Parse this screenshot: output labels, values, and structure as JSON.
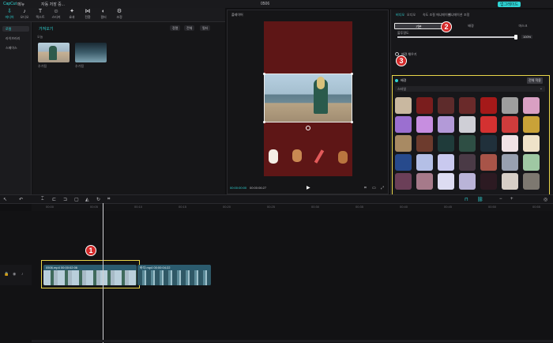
{
  "titlebar": {
    "app_label": "CapCut",
    "menu": "메뉴",
    "autosave": "자동 저장 중...",
    "title": "0506",
    "upgrade": "업그레이드"
  },
  "toolbar": {
    "tools": [
      {
        "icon": "media-icon",
        "label": "미디어"
      },
      {
        "icon": "audio-icon",
        "label": "오디오"
      },
      {
        "icon": "text-icon",
        "label": "텍스트"
      },
      {
        "icon": "sticker-icon",
        "label": "스티커"
      },
      {
        "icon": "effects-icon",
        "label": "효과"
      },
      {
        "icon": "transition-icon",
        "label": "전환"
      },
      {
        "icon": "filter-icon",
        "label": "필터"
      },
      {
        "icon": "adjust-icon",
        "label": "조정"
      }
    ]
  },
  "leftnav": {
    "items": [
      "로컬",
      "라이브러리",
      "스페이스"
    ]
  },
  "media": {
    "header": "가져오기",
    "section": "오늘",
    "buttons": [
      "정렬",
      "전체",
      "필터"
    ],
    "items": [
      {
        "caption": "추가됨"
      },
      {
        "caption": "추가됨"
      }
    ]
  },
  "player": {
    "header": "플레이어",
    "timecode_current": "00:00:00:00",
    "timecode_total": "00:00:06:27"
  },
  "props": {
    "tabs": [
      "비디오",
      "오디오",
      "속도 조절 애니메이션",
      "애니메이션",
      "조정"
    ],
    "segments": [
      "기본",
      "배경",
      "마스크"
    ],
    "blend_label": "불투명도",
    "blend_value": "100%",
    "bg_toggle_label": "배경 채우기",
    "bg_section": {
      "title": "배경",
      "apply_all": "전체 적용",
      "dropdown": "스타일"
    }
  },
  "badges": [
    "1",
    "2",
    "3"
  ],
  "bg_swatches": [
    "#c9b8a0",
    "#7a1d1d",
    "#5d2b2b",
    "#6a2a2a",
    "#a51919",
    "#9e9e9e",
    "#d9a0c3",
    "#9b6fd0",
    "#c78ee0",
    "#b39ad8",
    "#cfcfd6",
    "#d43131",
    "#cf3c3c",
    "#c9a238",
    "#a88a63",
    "#6d3b2d",
    "#1f3b3a",
    "#2e4e44",
    "#20303b",
    "#f0e2e5",
    "#efe2c9",
    "#274a8c",
    "#b4bfe6",
    "#c9c9ef",
    "#4a3a46",
    "#a85448",
    "#98a0b0",
    "#9fc8a3",
    "#6b3f58",
    "#a67a8a",
    "#dddcf2",
    "#b9b4d8",
    "#2c1a22",
    "#d7cfc7",
    "#7d7870"
  ],
  "timeline": {
    "clip1_label": "0506.mp4  00:00:02:06",
    "clip2_label": "바다.mp4  00:00:04:22",
    "ticks": [
      "00:00",
      "00:05",
      "00:10",
      "00:15",
      "00:20",
      "00:25",
      "00:30",
      "00:35",
      "00:40",
      "00:45",
      "00:50",
      "00:55"
    ]
  }
}
